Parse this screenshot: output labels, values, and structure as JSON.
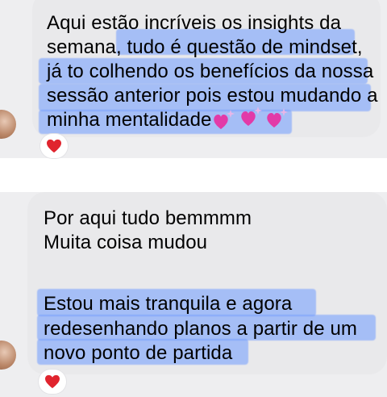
{
  "messages": [
    {
      "lines": [
        "Aqui estão incríveis os insights da",
        "semana, tudo é questão de mindset,",
        "já to colhendo os benefícios da nossa",
        "sessão anterior pois estou mudando a",
        "minha mentalidade"
      ],
      "emoji": "sparkling-heart-icon",
      "reaction": "heart-icon"
    },
    {
      "lines": [
        "Por aqui tudo bemmmm",
        "Muita coisa mudou",
        "",
        "Estou mais tranquila e agora",
        "redesenhando planos a partir de um",
        "novo ponto de partida"
      ],
      "reaction": "heart-icon"
    }
  ],
  "colors": {
    "highlight": "#6f9bff",
    "bubble": "#e9e9eb",
    "heart": "#e0242e",
    "emoji_heart": "#e23aa8"
  }
}
